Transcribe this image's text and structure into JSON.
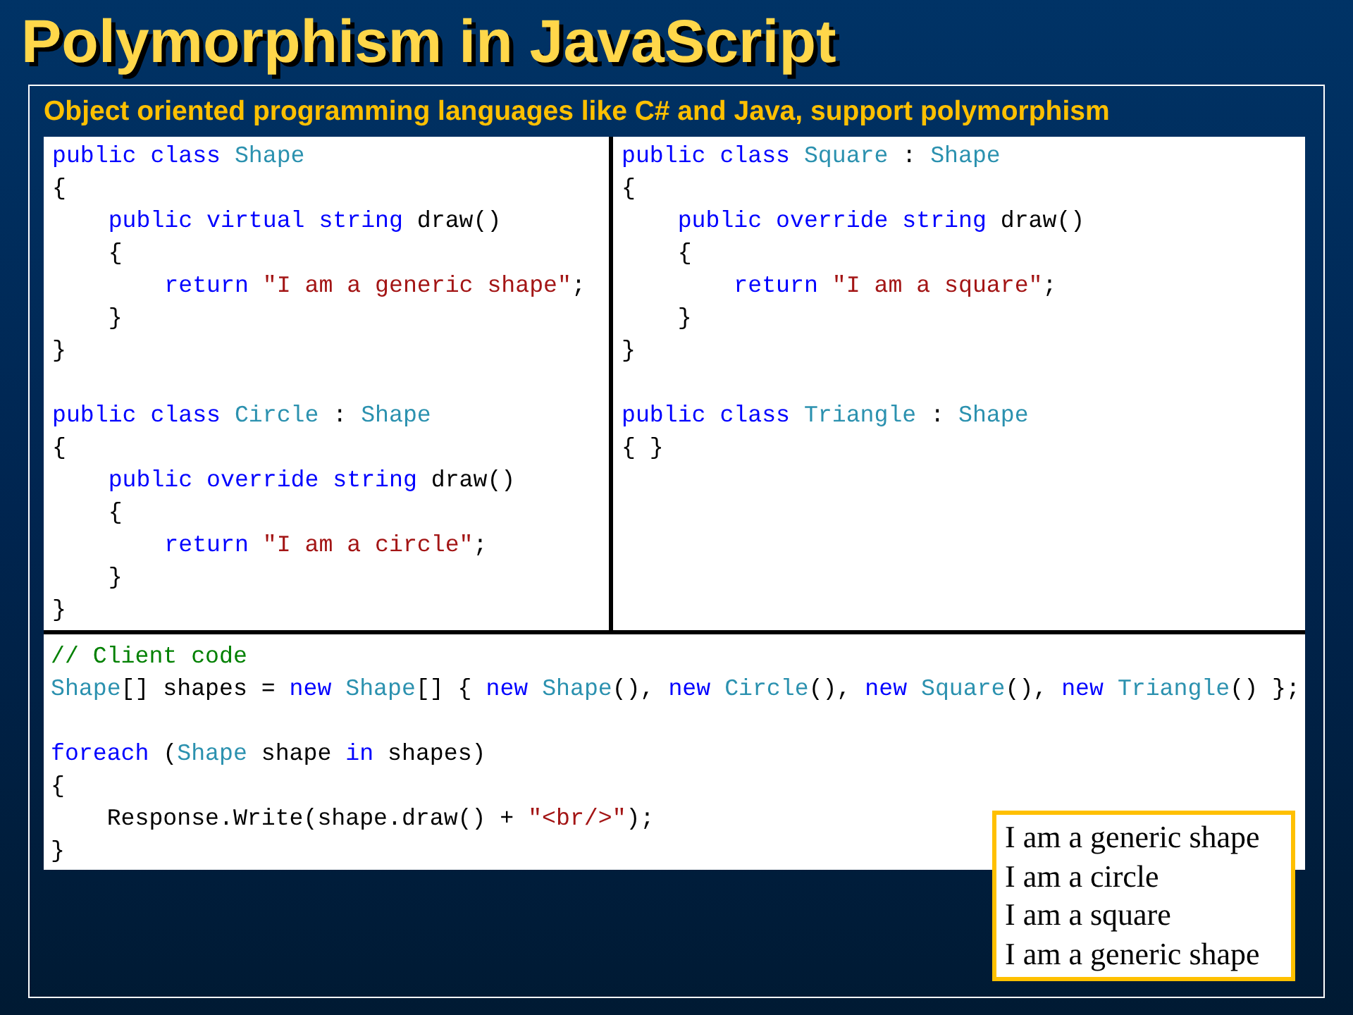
{
  "title": "Polymorphism in JavaScript",
  "subtitle": "Object oriented programming languages like C# and Java, support polymorphism",
  "code_panels": [
    {
      "blocks": [
        [
          [
            {
              "kind": "keyword",
              "text": "public class "
            },
            {
              "kind": "type",
              "text": "Shape"
            }
          ],
          [
            {
              "kind": "plain",
              "text": "{"
            }
          ],
          [
            {
              "kind": "keyword",
              "text": "    public virtual string"
            },
            {
              "kind": "plain",
              "text": " draw()"
            }
          ],
          [
            {
              "kind": "plain",
              "text": "    {"
            }
          ],
          [
            {
              "kind": "keyword",
              "text": "        return "
            },
            {
              "kind": "string",
              "text": "\"I am a generic shape\""
            },
            {
              "kind": "plain",
              "text": ";"
            }
          ],
          [
            {
              "kind": "plain",
              "text": "    }"
            }
          ],
          [
            {
              "kind": "plain",
              "text": "}"
            }
          ]
        ],
        [
          [
            {
              "kind": "keyword",
              "text": "public class "
            },
            {
              "kind": "type",
              "text": "Circle"
            },
            {
              "kind": "plain",
              "text": " : "
            },
            {
              "kind": "type",
              "text": "Shape"
            }
          ],
          [
            {
              "kind": "plain",
              "text": "{"
            }
          ],
          [
            {
              "kind": "keyword",
              "text": "    public override string"
            },
            {
              "kind": "plain",
              "text": " draw()"
            }
          ],
          [
            {
              "kind": "plain",
              "text": "    {"
            }
          ],
          [
            {
              "kind": "keyword",
              "text": "        return "
            },
            {
              "kind": "string",
              "text": "\"I am a circle\""
            },
            {
              "kind": "plain",
              "text": ";"
            }
          ],
          [
            {
              "kind": "plain",
              "text": "    }"
            }
          ],
          [
            {
              "kind": "plain",
              "text": "}"
            }
          ]
        ]
      ]
    },
    {
      "blocks": [
        [
          [
            {
              "kind": "keyword",
              "text": "public class "
            },
            {
              "kind": "type",
              "text": "Square"
            },
            {
              "kind": "plain",
              "text": " : "
            },
            {
              "kind": "type",
              "text": "Shape"
            }
          ],
          [
            {
              "kind": "plain",
              "text": "{"
            }
          ],
          [
            {
              "kind": "keyword",
              "text": "    public override string"
            },
            {
              "kind": "plain",
              "text": " draw()"
            }
          ],
          [
            {
              "kind": "plain",
              "text": "    {"
            }
          ],
          [
            {
              "kind": "keyword",
              "text": "        return "
            },
            {
              "kind": "string",
              "text": "\"I am a square\""
            },
            {
              "kind": "plain",
              "text": ";"
            }
          ],
          [
            {
              "kind": "plain",
              "text": "    }"
            }
          ],
          [
            {
              "kind": "plain",
              "text": "}"
            }
          ]
        ],
        [
          [
            {
              "kind": "keyword",
              "text": "public class "
            },
            {
              "kind": "type",
              "text": "Triangle"
            },
            {
              "kind": "plain",
              "text": " : "
            },
            {
              "kind": "type",
              "text": "Shape"
            }
          ],
          [
            {
              "kind": "plain",
              "text": "{ }"
            }
          ]
        ]
      ]
    },
    {
      "blocks": [
        [
          [
            {
              "kind": "comment",
              "text": "// Client code"
            }
          ],
          [
            {
              "kind": "type",
              "text": "Shape"
            },
            {
              "kind": "plain",
              "text": "[] shapes = "
            },
            {
              "kind": "keyword",
              "text": "new "
            },
            {
              "kind": "type",
              "text": "Shape"
            },
            {
              "kind": "plain",
              "text": "[] { "
            },
            {
              "kind": "keyword",
              "text": "new "
            },
            {
              "kind": "type",
              "text": "Shape"
            },
            {
              "kind": "plain",
              "text": "(), "
            },
            {
              "kind": "keyword",
              "text": "new "
            },
            {
              "kind": "type",
              "text": "Circle"
            },
            {
              "kind": "plain",
              "text": "(), "
            },
            {
              "kind": "keyword",
              "text": "new "
            },
            {
              "kind": "type",
              "text": "Square"
            },
            {
              "kind": "plain",
              "text": "(), "
            },
            {
              "kind": "keyword",
              "text": "new "
            },
            {
              "kind": "type",
              "text": "Triangle"
            },
            {
              "kind": "plain",
              "text": "() };"
            }
          ]
        ],
        [
          [
            {
              "kind": "keyword",
              "text": "foreach"
            },
            {
              "kind": "plain",
              "text": " ("
            },
            {
              "kind": "type",
              "text": "Shape"
            },
            {
              "kind": "plain",
              "text": " shape "
            },
            {
              "kind": "keyword",
              "text": "in"
            },
            {
              "kind": "plain",
              "text": " shapes)"
            }
          ],
          [
            {
              "kind": "plain",
              "text": "{"
            }
          ],
          [
            {
              "kind": "plain",
              "text": "    Response.Write(shape.draw() + "
            },
            {
              "kind": "string",
              "text": "\"<br/>\""
            },
            {
              "kind": "plain",
              "text": ");"
            }
          ],
          [
            {
              "kind": "plain",
              "text": "}"
            }
          ]
        ]
      ]
    }
  ],
  "output": {
    "lines": [
      "I am a generic shape",
      "I am a circle",
      "I am a square",
      "I am a generic shape"
    ]
  }
}
